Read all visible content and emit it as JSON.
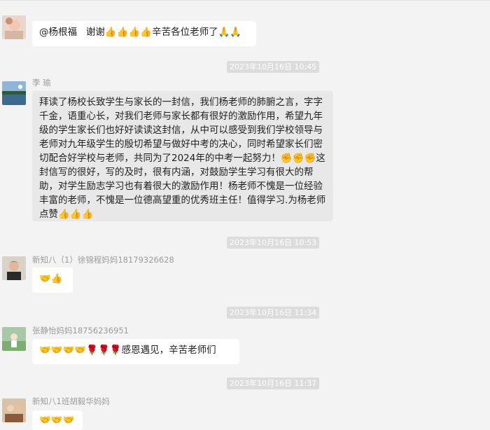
{
  "messages": [
    {
      "id": "m1",
      "sender": "",
      "text": "@杨根福   谢谢👍👍👍👍辛苦各位老师了🙏🙏"
    },
    {
      "id": "t1",
      "timestamp": "2023年10月16日 10:45"
    },
    {
      "id": "m2",
      "sender": "李    瑜",
      "text": "拜读了杨校长致学生与家长的一封信，我们杨老师的肺腑之言，字字千金，语重心长，对我们老师与家长都有很好的激励作用，希望九年级的学生家长们也好好读读这封信，从中可以感受到我们学校领导与老师对九年级学生的殷切希望与做好中考的决心，同时希望家长们密切配合好学校与老师，共同为了2024年的中考一起努力！✊✊✊这封信写的很好，写的及时，很有内涵，对鼓励学生学习有很大的帮助，对学生励志学习也有着很大的激励作用！杨老师不愧是一位经验丰富的老师，不愧是一位德高望重的优秀班主任！值得学习.为杨老师点赞👍👍👍"
    },
    {
      "id": "t2",
      "timestamp": "2023年10月16日 10:53"
    },
    {
      "id": "m3",
      "sender": "新知八（1）徐锦程妈妈18179326628",
      "text": "🤝👍"
    },
    {
      "id": "t3",
      "timestamp": "2023年10月16日 11:34"
    },
    {
      "id": "m4",
      "sender": "张静怡妈妈18756236951",
      "text": "🤝🤝🤝🤝🌹🌹🌹感恩遇见，辛苦老师们"
    },
    {
      "id": "t4",
      "timestamp": "2023年10月16日 11:37"
    },
    {
      "id": "m5",
      "sender": "新知八1班胡毅华妈妈",
      "text": "🤝🤝🤝"
    }
  ],
  "colors": {
    "background": "#f3f3f3",
    "bubble_white": "#ffffff",
    "bubble_gray": "#e8e8e8",
    "timestamp_bg": "#dcdcdc",
    "sender_text": "#9b9b9b"
  }
}
